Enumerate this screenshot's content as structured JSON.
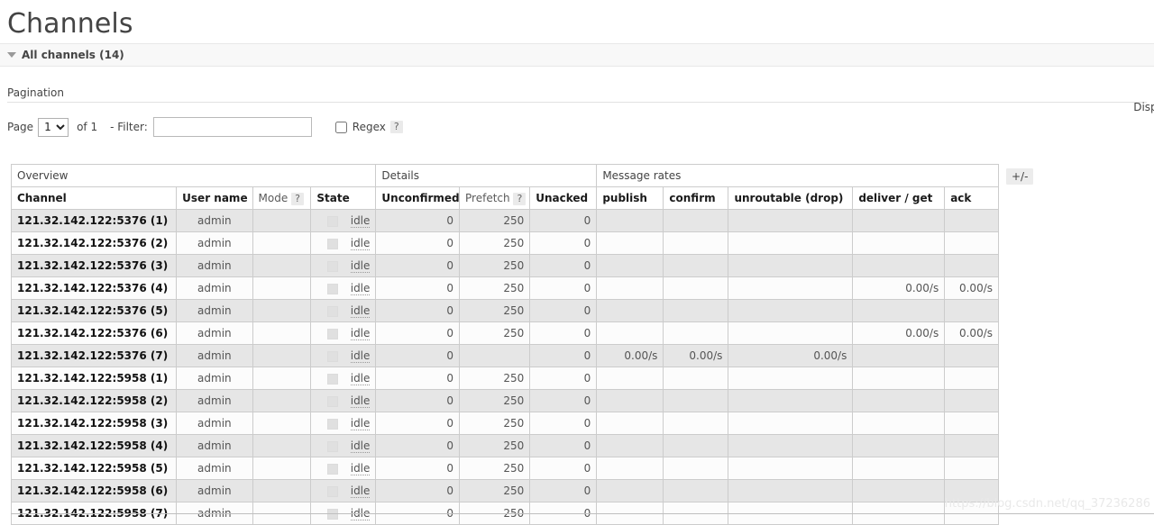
{
  "page": {
    "title": "Channels",
    "section_label": "All channels (14)"
  },
  "pagination": {
    "label": "Pagination",
    "page_label": "Page",
    "page_value": "1",
    "page_options": [
      "1"
    ],
    "of_label": "of 1",
    "filter_label": "- Filter:",
    "filter_value": "",
    "filter_placeholder": "",
    "regex_label": "Regex",
    "regex_help": "?",
    "regex_checked": false,
    "displaying_text": "Displaying"
  },
  "table": {
    "plus_minus_label": "+/-",
    "group_headers": [
      {
        "label": "Overview",
        "span": 4
      },
      {
        "label": "Details",
        "span": 3
      },
      {
        "label": "Message rates",
        "span": 5
      }
    ],
    "columns": [
      {
        "label": "Channel",
        "style": "bold",
        "align": "left"
      },
      {
        "label": "User name",
        "style": "bold",
        "align": "left"
      },
      {
        "label": "Mode",
        "style": "light",
        "align": "left",
        "help": "?"
      },
      {
        "label": "State",
        "style": "bold",
        "align": "left"
      },
      {
        "label": "Unconfirmed",
        "style": "bold",
        "align": "left"
      },
      {
        "label": "Prefetch",
        "style": "light",
        "align": "left",
        "help": "?"
      },
      {
        "label": "Unacked",
        "style": "bold",
        "align": "left"
      },
      {
        "label": "publish",
        "style": "bold",
        "align": "left"
      },
      {
        "label": "confirm",
        "style": "bold",
        "align": "left"
      },
      {
        "label": "unroutable (drop)",
        "style": "bold",
        "align": "left"
      },
      {
        "label": "deliver / get",
        "style": "bold",
        "align": "left"
      },
      {
        "label": "ack",
        "style": "bold",
        "align": "left"
      }
    ],
    "rows": [
      {
        "channel": "121.32.142.122:5376 (1)",
        "user": "admin",
        "mode": "",
        "state": "idle",
        "unconfirmed": "0",
        "prefetch": "250",
        "unacked": "0",
        "publish": "",
        "confirm": "",
        "unroutable": "",
        "deliver_get": "",
        "ack": ""
      },
      {
        "channel": "121.32.142.122:5376 (2)",
        "user": "admin",
        "mode": "",
        "state": "idle",
        "unconfirmed": "0",
        "prefetch": "250",
        "unacked": "0",
        "publish": "",
        "confirm": "",
        "unroutable": "",
        "deliver_get": "",
        "ack": ""
      },
      {
        "channel": "121.32.142.122:5376 (3)",
        "user": "admin",
        "mode": "",
        "state": "idle",
        "unconfirmed": "0",
        "prefetch": "250",
        "unacked": "0",
        "publish": "",
        "confirm": "",
        "unroutable": "",
        "deliver_get": "",
        "ack": ""
      },
      {
        "channel": "121.32.142.122:5376 (4)",
        "user": "admin",
        "mode": "",
        "state": "idle",
        "unconfirmed": "0",
        "prefetch": "250",
        "unacked": "0",
        "publish": "",
        "confirm": "",
        "unroutable": "",
        "deliver_get": "0.00/s",
        "ack": "0.00/s"
      },
      {
        "channel": "121.32.142.122:5376 (5)",
        "user": "admin",
        "mode": "",
        "state": "idle",
        "unconfirmed": "0",
        "prefetch": "250",
        "unacked": "0",
        "publish": "",
        "confirm": "",
        "unroutable": "",
        "deliver_get": "",
        "ack": ""
      },
      {
        "channel": "121.32.142.122:5376 (6)",
        "user": "admin",
        "mode": "",
        "state": "idle",
        "unconfirmed": "0",
        "prefetch": "250",
        "unacked": "0",
        "publish": "",
        "confirm": "",
        "unroutable": "",
        "deliver_get": "0.00/s",
        "ack": "0.00/s"
      },
      {
        "channel": "121.32.142.122:5376 (7)",
        "user": "admin",
        "mode": "",
        "state": "idle",
        "unconfirmed": "0",
        "prefetch": "",
        "unacked": "0",
        "publish": "0.00/s",
        "confirm": "0.00/s",
        "unroutable": "0.00/s",
        "deliver_get": "",
        "ack": ""
      },
      {
        "channel": "121.32.142.122:5958 (1)",
        "user": "admin",
        "mode": "",
        "state": "idle",
        "unconfirmed": "0",
        "prefetch": "250",
        "unacked": "0",
        "publish": "",
        "confirm": "",
        "unroutable": "",
        "deliver_get": "",
        "ack": ""
      },
      {
        "channel": "121.32.142.122:5958 (2)",
        "user": "admin",
        "mode": "",
        "state": "idle",
        "unconfirmed": "0",
        "prefetch": "250",
        "unacked": "0",
        "publish": "",
        "confirm": "",
        "unroutable": "",
        "deliver_get": "",
        "ack": ""
      },
      {
        "channel": "121.32.142.122:5958 (3)",
        "user": "admin",
        "mode": "",
        "state": "idle",
        "unconfirmed": "0",
        "prefetch": "250",
        "unacked": "0",
        "publish": "",
        "confirm": "",
        "unroutable": "",
        "deliver_get": "",
        "ack": ""
      },
      {
        "channel": "121.32.142.122:5958 (4)",
        "user": "admin",
        "mode": "",
        "state": "idle",
        "unconfirmed": "0",
        "prefetch": "250",
        "unacked": "0",
        "publish": "",
        "confirm": "",
        "unroutable": "",
        "deliver_get": "",
        "ack": ""
      },
      {
        "channel": "121.32.142.122:5958 (5)",
        "user": "admin",
        "mode": "",
        "state": "idle",
        "unconfirmed": "0",
        "prefetch": "250",
        "unacked": "0",
        "publish": "",
        "confirm": "",
        "unroutable": "",
        "deliver_get": "",
        "ack": ""
      },
      {
        "channel": "121.32.142.122:5958 (6)",
        "user": "admin",
        "mode": "",
        "state": "idle",
        "unconfirmed": "0",
        "prefetch": "250",
        "unacked": "0",
        "publish": "",
        "confirm": "",
        "unroutable": "",
        "deliver_get": "",
        "ack": ""
      },
      {
        "channel": "121.32.142.122:5958 (7)",
        "user": "admin",
        "mode": "",
        "state": "idle",
        "unconfirmed": "0",
        "prefetch": "250",
        "unacked": "0",
        "publish": "",
        "confirm": "",
        "unroutable": "",
        "deliver_get": "",
        "ack": ""
      }
    ]
  },
  "watermark": {
    "text": "https://blog.csdn.net/qq_37236286"
  },
  "colors": {
    "row_odd": "#e6e6e6",
    "row_even": "#fcfcfc",
    "border": "#cccccc",
    "section_bg": "#f8f8f8",
    "help_badge": "#eaeaea"
  }
}
